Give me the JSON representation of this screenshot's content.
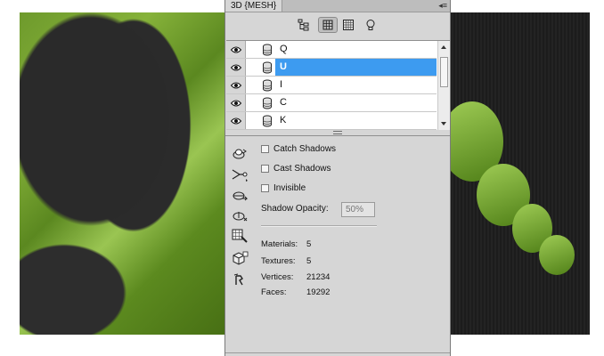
{
  "panel": {
    "tab_title": "3D {MESH}",
    "menu_glyph": "◂≡"
  },
  "toolbar": {
    "icons": [
      "scene-icon",
      "mesh-icon",
      "materials-icon",
      "lights-icon"
    ],
    "active": "mesh-icon"
  },
  "meshes": [
    {
      "name": "Q",
      "visible": true,
      "selected": false
    },
    {
      "name": "U",
      "visible": true,
      "selected": true
    },
    {
      "name": "I",
      "visible": true,
      "selected": false
    },
    {
      "name": "C",
      "visible": true,
      "selected": false
    },
    {
      "name": "K",
      "visible": true,
      "selected": false
    }
  ],
  "properties": {
    "catch_shadows": {
      "label": "Catch Shadows",
      "checked": false
    },
    "cast_shadows": {
      "label": "Cast Shadows",
      "checked": false
    },
    "invisible": {
      "label": "Invisible",
      "checked": false
    },
    "shadow_opacity_label": "Shadow Opacity:",
    "shadow_opacity_value": "50%"
  },
  "stats": {
    "materials": {
      "label": "Materials:",
      "value": "5"
    },
    "textures": {
      "label": "Textures:",
      "value": "5"
    },
    "vertices": {
      "label": "Vertices:",
      "value": "21234"
    },
    "faces": {
      "label": "Faces:",
      "value": "19292"
    }
  },
  "colors": {
    "selection": "#3d9bf0",
    "panel_bg": "#d6d6d6"
  }
}
